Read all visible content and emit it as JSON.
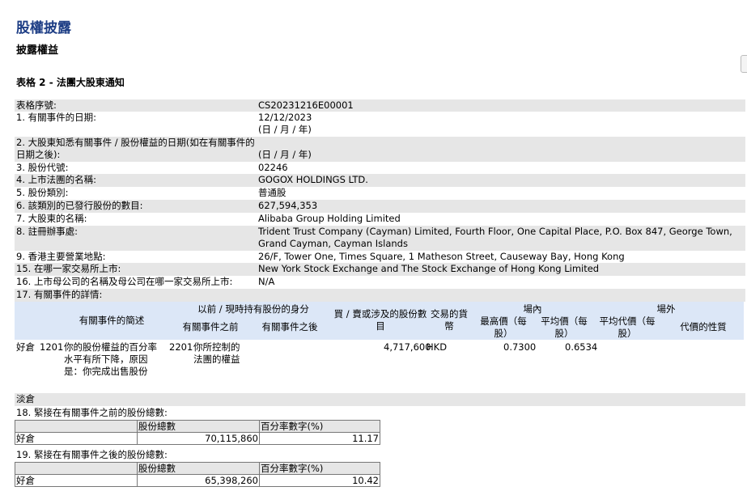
{
  "page": {
    "title": "股權披露",
    "subtitle": "披露權益",
    "form_title": "表格 2 - 法團大股東通知"
  },
  "fields": [
    {
      "label": "表格序號:",
      "value": "CS20231216E00001",
      "shade": true
    },
    {
      "label": "1. 有關事件的日期:",
      "value": "12/12/2023",
      "note": "(日 / 月 / 年)",
      "shade": false
    },
    {
      "label": "2. 大股東知悉有關事件 / 股份權益的日期(如在有關事件的日期之後):",
      "value": "",
      "note": "(日 / 月 / 年)",
      "shade": true
    },
    {
      "label": "3. 股份代號:",
      "value": "02246",
      "shade": false
    },
    {
      "label": "4. 上市法團的名稱:",
      "value": "GOGOX HOLDINGS LTD.",
      "shade": true
    },
    {
      "label": "5. 股份類別:",
      "value": "普通股",
      "shade": false
    },
    {
      "label": "6. 該類別的已發行股份的數目:",
      "value": "627,594,353",
      "shade": true
    },
    {
      "label": "7. 大股東的名稱:",
      "value": "Alibaba Group Holding Limited",
      "shade": false
    },
    {
      "label": "8. 註冊辦事處:",
      "value": "Trident Trust Company (Cayman) Limited, Fourth Floor, One Capital Place, P.O. Box 847, George Town, Grand Cayman, Cayman Islands",
      "shade": true
    },
    {
      "label": "9. 香港主要營業地點:",
      "value": "26/F, Tower One, Times Square, 1 Matheson Street, Causeway Bay, Hong Kong",
      "shade": false
    },
    {
      "label": "15. 在哪一家交易所上市:",
      "value": "New York Stock Exchange and The Stock Exchange of Hong Kong Limited",
      "shade": true
    },
    {
      "label": "16. 上市母公司的名稱及母公司在哪一家交易所上市:",
      "value": "N/A",
      "shade": false
    },
    {
      "label": "17. 有關事件的詳情:",
      "value": "",
      "shade": true
    }
  ],
  "event_table": {
    "headers": {
      "description": "有關事件的簡述",
      "held": "以前 / 現時持有股份的身分",
      "before": "有關事件之前",
      "after": "有關事件之後",
      "shares": "買 / 賣或涉及的股份數目",
      "currency": "交易的貨幣",
      "onex": "場內",
      "offex": "場外",
      "high": "最高價（每股）",
      "avg": "平均價（每股）",
      "avg_off": "平均代價（每股）",
      "nature": "代價的性質"
    },
    "row": {
      "position": "好倉",
      "code": "1201",
      "description": "你的股份權益的百分率水平有所下降，原因是：你完成出售股份",
      "capacity_code": "2201",
      "capacity": "你所控制的法團的權益",
      "shares": "4,717,600",
      "currency": "HKD",
      "high": "0.7300",
      "avg": "0.6534"
    },
    "short_label": "淡倉"
  },
  "section18": {
    "title": "18. 緊接在有關事件之前的股份總數:",
    "col_total": "股份總數",
    "col_pct": "百分率數字(%)",
    "row_label": "好倉",
    "total": "70,115,860",
    "pct": "11.17"
  },
  "section19": {
    "title": "19. 緊接在有關事件之後的股份總數:",
    "col_total": "股份總數",
    "col_pct": "百分率數字(%)",
    "row_label": "好倉",
    "total": "65,398,260",
    "pct": "10.42"
  }
}
